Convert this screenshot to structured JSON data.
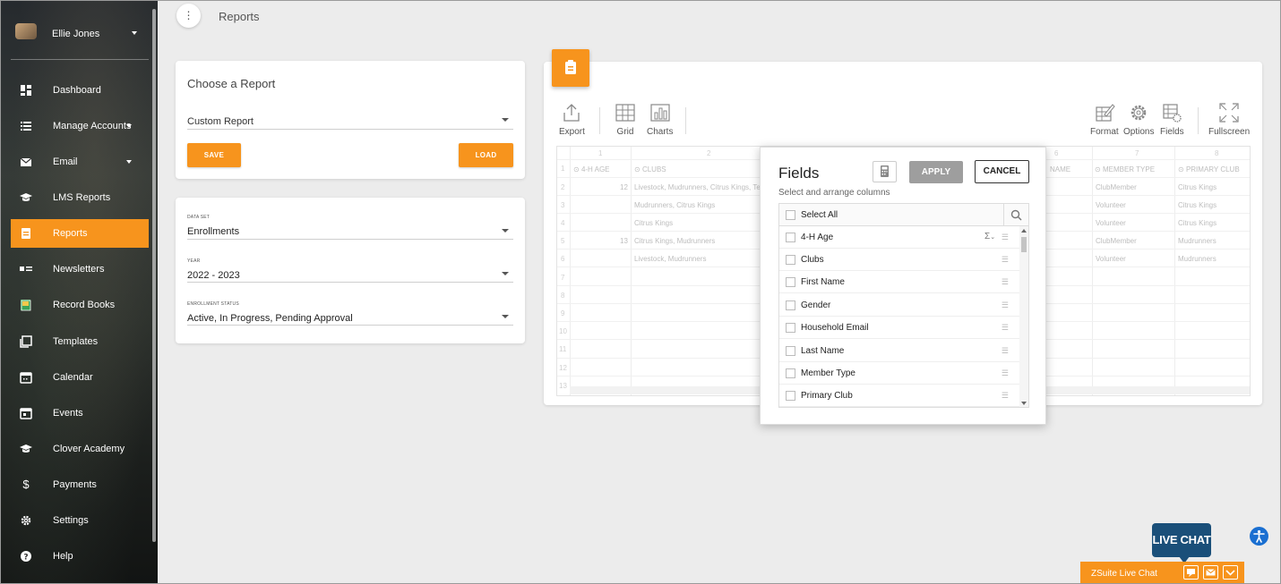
{
  "user": {
    "name": "Ellie Jones"
  },
  "nav": [
    {
      "label": "Dashboard",
      "icon": "dashboard-icon",
      "active": false
    },
    {
      "label": "Manage Accounts",
      "icon": "list-icon",
      "active": false
    },
    {
      "label": "Email",
      "icon": "mail-icon",
      "active": false
    },
    {
      "label": "LMS Reports",
      "icon": "graduation-cap-icon",
      "active": false
    },
    {
      "label": "Reports",
      "icon": "clipboard-icon",
      "active": true
    },
    {
      "label": "Newsletters",
      "icon": "newsletter-icon",
      "active": false
    },
    {
      "label": "Record Books",
      "icon": "book-icon",
      "active": false
    },
    {
      "label": "Templates",
      "icon": "template-icon",
      "active": false
    },
    {
      "label": "Calendar",
      "icon": "calendar-icon",
      "active": false
    },
    {
      "label": "Events",
      "icon": "event-icon",
      "active": false
    },
    {
      "label": "Clover Academy",
      "icon": "graduation-cap-icon",
      "active": false
    },
    {
      "label": "Payments",
      "icon": "dollar-icon",
      "active": false
    },
    {
      "label": "Settings",
      "icon": "gear-icon",
      "active": false
    },
    {
      "label": "Help",
      "icon": "help-icon",
      "active": false
    }
  ],
  "page": {
    "title": "Reports"
  },
  "choose_report": {
    "title": "Choose a Report",
    "selected": "Custom Report",
    "save_label": "SAVE",
    "load_label": "LOAD"
  },
  "filters": {
    "dataset_caption": "DATA SET",
    "dataset_value": "Enrollments",
    "year_caption": "YEAR",
    "year_value": "2022 - 2023",
    "status_caption": "ENROLLMENT STATUS",
    "status_value": "Active, In Progress, Pending Approval"
  },
  "toolbar": {
    "export": "Export",
    "grid": "Grid",
    "charts": "Charts",
    "format": "Format",
    "options": "Options",
    "fields": "Fields",
    "fullscreen": "Fullscreen"
  },
  "grid": {
    "col_numbers": [
      "1",
      "2",
      "6",
      "7",
      "8"
    ],
    "headers": {
      "age": "4-H AGE",
      "clubs": "CLUBS",
      "name_partial": "NAME",
      "member_type": "MEMBER TYPE",
      "primary_club": "PRIMARY CLUB"
    },
    "row_numbers": [
      "1",
      "2",
      "3",
      "4",
      "5",
      "6",
      "7",
      "8",
      "9",
      "10",
      "11",
      "12",
      "13"
    ],
    "rows": [
      {
        "age": "12",
        "clubs": "Livestock, Mudrunners, Citrus Kings, Te",
        "member_type": "ClubMember",
        "primary_club": "Citrus Kings"
      },
      {
        "age": "",
        "clubs": "Mudrunners, Citrus Kings",
        "member_type": "Volunteer",
        "primary_club": "Citrus Kings"
      },
      {
        "age": "",
        "clubs": "Citrus Kings",
        "member_type": "Volunteer",
        "primary_club": "Citrus Kings"
      },
      {
        "age": "13",
        "clubs": "Citrus Kings, Mudrunners",
        "member_type": "ClubMember",
        "primary_club": "Mudrunners"
      },
      {
        "age": "",
        "clubs": "Livestock, Mudrunners",
        "member_type": "Volunteer",
        "primary_club": "Mudrunners"
      }
    ]
  },
  "fields_panel": {
    "title": "Fields",
    "subtitle": "Select and arrange columns",
    "apply_label": "APPLY",
    "cancel_label": "CANCEL",
    "select_all": "Select All",
    "sum_symbol": "Σ",
    "items": [
      "4-H Age",
      "Clubs",
      "First Name",
      "Gender",
      "Household Email",
      "Last Name",
      "Member Type",
      "Primary Club"
    ]
  },
  "live_chat": {
    "bubble": "LIVE CHAT",
    "bar_label": "ZSuite Live Chat"
  },
  "colors": {
    "accent": "#f7941d",
    "chat_blue": "#1a4f79"
  }
}
